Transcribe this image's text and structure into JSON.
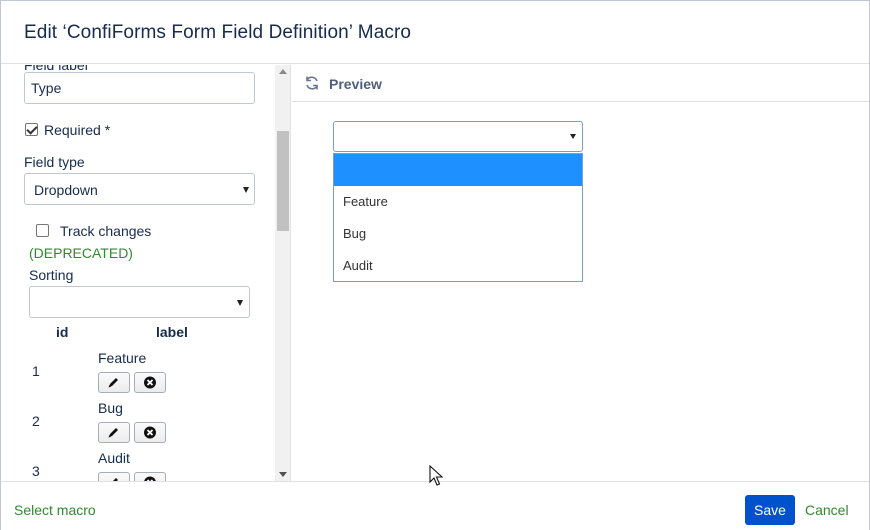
{
  "dialog": {
    "title": "Edit ‘ConfiForms Form Field Definition’ Macro"
  },
  "left": {
    "field_label_cut": "Field label",
    "field_label_value": "Type",
    "required_label": "Required *",
    "required_checked": true,
    "field_type_label": "Field type",
    "field_type_value": "Dropdown",
    "track_changes_label": "Track changes",
    "track_changes_checked": false,
    "deprecated_label": "(DEPRECATED)",
    "sorting_label": "Sorting",
    "sorting_value": "",
    "table": {
      "headers": [
        "id",
        "label"
      ],
      "rows": [
        {
          "id": "1",
          "label": "Feature"
        },
        {
          "id": "2",
          "label": "Bug"
        },
        {
          "id": "3",
          "label": "Audit"
        }
      ]
    }
  },
  "preview": {
    "label": "Preview",
    "select_value": "",
    "options": [
      "",
      "Feature",
      "Bug",
      "Audit"
    ]
  },
  "footer": {
    "select_macro": "Select macro",
    "save": "Save",
    "cancel": "Cancel"
  },
  "colors": {
    "primary": "#0052cc",
    "link_green": "#2f8a2f",
    "highlight": "#1e90ff"
  }
}
